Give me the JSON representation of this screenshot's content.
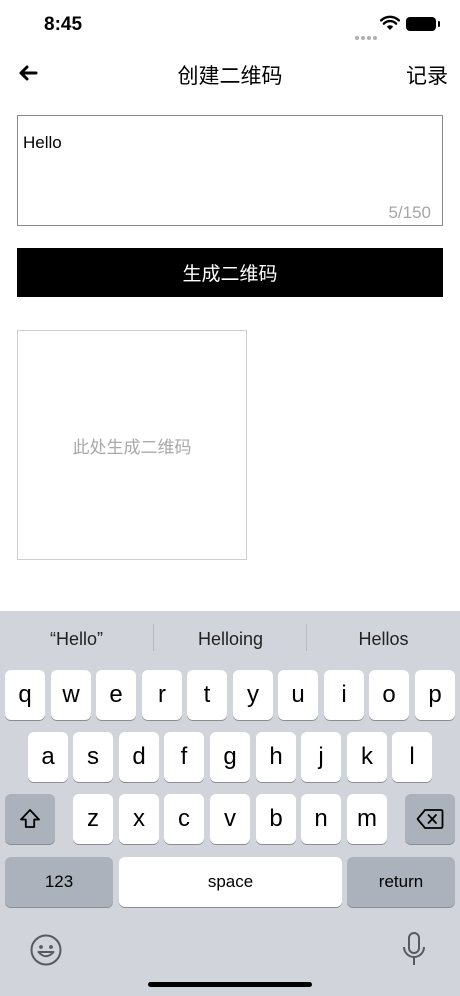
{
  "status_bar": {
    "time": "8:45"
  },
  "nav": {
    "title": "创建二维码",
    "record_label": "记录"
  },
  "input": {
    "value": "Hello",
    "counter": "5/150"
  },
  "generate_button": {
    "label": "生成二维码"
  },
  "qr_placeholder": {
    "text": "此处生成二维码"
  },
  "keyboard": {
    "suggestions": [
      "“Hello”",
      "Helloing",
      "Hellos"
    ],
    "row1": [
      "q",
      "w",
      "e",
      "r",
      "t",
      "y",
      "u",
      "i",
      "o",
      "p"
    ],
    "row2": [
      "a",
      "s",
      "d",
      "f",
      "g",
      "h",
      "j",
      "k",
      "l"
    ],
    "row3": [
      "z",
      "x",
      "c",
      "v",
      "b",
      "n",
      "m"
    ],
    "numbers_label": "123",
    "space_label": "space",
    "return_label": "return"
  },
  "icons": {
    "back": "arrow-left-icon",
    "shift": "shift-icon",
    "delete": "backspace-icon",
    "emoji": "emoji-icon",
    "mic": "microphone-icon"
  }
}
